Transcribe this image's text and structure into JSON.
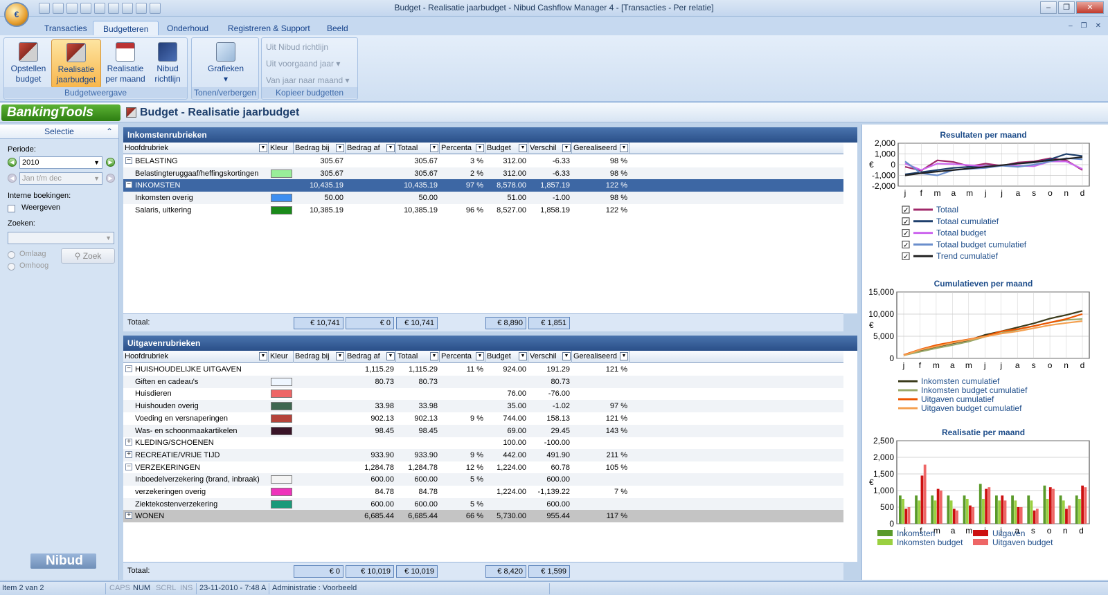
{
  "window_title": "Budget - Realisatie jaarbudget - Nibud Cashflow Manager 4 - [Transacties - Per relatie]",
  "tabs": [
    "Transacties",
    "Budgetteren",
    "Onderhoud",
    "Registreren & Support",
    "Beeld"
  ],
  "ribbon": {
    "group1_label": "Budgetweergave",
    "btn_opstellen": [
      "Opstellen",
      "budget"
    ],
    "btn_realisatie_jaar": [
      "Realisatie",
      "jaarbudget"
    ],
    "btn_realisatie_maand": [
      "Realisatie",
      "per maand"
    ],
    "btn_nibud": [
      "Nibud",
      "richtlijn"
    ],
    "group2_label": "Tonen/verbergen",
    "btn_grafieken": "Grafieken",
    "group3_label": "Kopieer budgetten",
    "uit_nibud": "Uit Nibud richtlijn",
    "uit_voorgaand": "Uit voorgaand jaar",
    "van_jaar": "Van jaar naar maand"
  },
  "logo_text": "BankingTools",
  "page_title": "Budget - Realisatie jaarbudget",
  "sidebar": {
    "header": "Selectie",
    "periode_label": "Periode:",
    "year_value": "2010",
    "month_range": "Jan t/m dec",
    "interne_label": "Interne boekingen:",
    "weergeven": "Weergeven",
    "zoeken_label": "Zoeken:",
    "omlaag": "Omlaag",
    "omhoog": "Omhoog",
    "zoek_button": "Zoek",
    "nibud_logo": "Nibud"
  },
  "columns": [
    "Hoofdrubriek",
    "Kleur",
    "Bedrag bij",
    "Bedrag af",
    "Totaal",
    "Percenta",
    "Budget",
    "Verschil",
    "Gerealiseerd"
  ],
  "income": {
    "title": "Inkomstenrubrieken",
    "rows": [
      {
        "exp": "−",
        "name": "BELASTING",
        "color": "",
        "bij": "305.67",
        "af": "",
        "tot": "305.67",
        "pct": "3 %",
        "bud": "312.00",
        "ver": "-6.33",
        "ger": "98 %",
        "bold": true
      },
      {
        "exp": "",
        "name": "Belastingteruggaaf/heffingskortingen",
        "color": "#99ee99",
        "bij": "305.67",
        "af": "",
        "tot": "305.67",
        "pct": "2 %",
        "bud": "312.00",
        "ver": "-6.33",
        "ger": "98 %"
      },
      {
        "exp": "−",
        "name": "INKOMSTEN",
        "color": "",
        "bij": "10,435.19",
        "af": "",
        "tot": "10,435.19",
        "pct": "97 %",
        "bud": "8,578.00",
        "ver": "1,857.19",
        "ger": "122 %",
        "sel": true
      },
      {
        "exp": "",
        "name": "Inkomsten overig",
        "color": "#3d8ef0",
        "bij": "50.00",
        "af": "",
        "tot": "50.00",
        "pct": "",
        "bud": "51.00",
        "ver": "-1.00",
        "ger": "98 %"
      },
      {
        "exp": "",
        "name": "Salaris, uitkering",
        "color": "#1a8a1a",
        "bij": "10,385.19",
        "af": "",
        "tot": "10,385.19",
        "pct": "96 %",
        "bud": "8,527.00",
        "ver": "1,858.19",
        "ger": "122 %"
      }
    ],
    "footer": {
      "label": "Totaal:",
      "bij": "€ 10,741",
      "af": "€ 0",
      "tot": "€ 10,741",
      "bud": "€ 8,890",
      "ver": "€ 1,851"
    }
  },
  "expense": {
    "title": "Uitgavenrubrieken",
    "rows": [
      {
        "exp": "−",
        "name": "HUISHOUDELIJKE UITGAVEN",
        "color": "",
        "bij": "",
        "af": "1,115.29",
        "tot": "1,115.29",
        "pct": "11 %",
        "bud": "924.00",
        "ver": "191.29",
        "ger": "121 %"
      },
      {
        "exp": "",
        "name": "Giften en cadeau's",
        "color": "#eef6ff",
        "bij": "",
        "af": "80.73",
        "tot": "80.73",
        "pct": "",
        "bud": "",
        "ver": "80.73",
        "ger": ""
      },
      {
        "exp": "",
        "name": "Huisdieren",
        "color": "#ee6666",
        "bij": "",
        "af": "",
        "tot": "",
        "pct": "",
        "bud": "76.00",
        "ver": "-76.00",
        "ger": ""
      },
      {
        "exp": "",
        "name": "Huishouden overig",
        "color": "#3e6650",
        "bij": "",
        "af": "33.98",
        "tot": "33.98",
        "pct": "",
        "bud": "35.00",
        "ver": "-1.02",
        "ger": "97 %"
      },
      {
        "exp": "",
        "name": "Voeding en versnaperingen",
        "color": "#b4433a",
        "bij": "",
        "af": "902.13",
        "tot": "902.13",
        "pct": "9 %",
        "bud": "744.00",
        "ver": "158.13",
        "ger": "121 %"
      },
      {
        "exp": "",
        "name": "Was- en schoonmaakartikelen",
        "color": "#3a1428",
        "bij": "",
        "af": "98.45",
        "tot": "98.45",
        "pct": "",
        "bud": "69.00",
        "ver": "29.45",
        "ger": "143 %"
      },
      {
        "exp": "+",
        "name": "KLEDING/SCHOENEN",
        "color": "",
        "bij": "",
        "af": "",
        "tot": "",
        "pct": "",
        "bud": "100.00",
        "ver": "-100.00",
        "ger": ""
      },
      {
        "exp": "+",
        "name": "RECREATIE/VRIJE TIJD",
        "color": "",
        "bij": "",
        "af": "933.90",
        "tot": "933.90",
        "pct": "9 %",
        "bud": "442.00",
        "ver": "491.90",
        "ger": "211 %"
      },
      {
        "exp": "−",
        "name": "VERZEKERINGEN",
        "color": "",
        "bij": "",
        "af": "1,284.78",
        "tot": "1,284.78",
        "pct": "12 %",
        "bud": "1,224.00",
        "ver": "60.78",
        "ger": "105 %"
      },
      {
        "exp": "",
        "name": "Inboedelverzekering (brand, inbraak)",
        "color": "#f4f4f4",
        "bij": "",
        "af": "600.00",
        "tot": "600.00",
        "pct": "5 %",
        "bud": "",
        "ver": "600.00",
        "ger": ""
      },
      {
        "exp": "",
        "name": "verzekeringen overig",
        "color": "#ee33bb",
        "bij": "",
        "af": "84.78",
        "tot": "84.78",
        "pct": "",
        "bud": "1,224.00",
        "ver": "-1,139.22",
        "ger": "7 %"
      },
      {
        "exp": "",
        "name": "Ziektekostenverzekering",
        "color": "#1a9a7a",
        "bij": "",
        "af": "600.00",
        "tot": "600.00",
        "pct": "5 %",
        "bud": "",
        "ver": "600.00",
        "ger": ""
      },
      {
        "exp": "+",
        "name": "WONEN",
        "color": "",
        "bij": "",
        "af": "6,685.44",
        "tot": "6,685.44",
        "pct": "66 %",
        "bud": "5,730.00",
        "ver": "955.44",
        "ger": "117 %",
        "grey": true
      }
    ],
    "footer": {
      "label": "Totaal:",
      "bij": "€ 0",
      "af": "€ 10,019",
      "tot": "€ 10,019",
      "bud": "€ 8,420",
      "ver": "€ 1,599"
    }
  },
  "chart_data": [
    {
      "type": "line",
      "title": "Resultaten per maand",
      "ylabel": "€",
      "categories": [
        "j",
        "f",
        "m",
        "a",
        "m",
        "j",
        "j",
        "a",
        "s",
        "o",
        "n",
        "d"
      ],
      "ylim": [
        -2000,
        2000
      ],
      "yticks": [
        "2,000",
        "1,000",
        "0",
        "-1,000",
        "-2,000"
      ],
      "series": [
        {
          "name": "Totaal",
          "color": "#a0286a",
          "values": [
            -200,
            -550,
            400,
            250,
            -150,
            100,
            -100,
            200,
            300,
            600,
            400,
            -500
          ]
        },
        {
          "name": "Totaal cumulatief",
          "color": "#1e3f6c",
          "values": [
            -900,
            -700,
            -500,
            -300,
            -200,
            -100,
            -100,
            100,
            200,
            500,
            1000,
            800
          ]
        },
        {
          "name": "Totaal budget",
          "color": "#cc66ee",
          "values": [
            100,
            -500,
            100,
            50,
            -50,
            -150,
            -50,
            -100,
            -150,
            300,
            300,
            -400
          ]
        },
        {
          "name": "Totaal budget cumulatief",
          "color": "#6a8ecc",
          "values": [
            300,
            -800,
            -1000,
            -500,
            -400,
            -300,
            -100,
            -200,
            0,
            300,
            600,
            500
          ]
        },
        {
          "name": "Trend cumulatief",
          "color": "#222222",
          "values": [
            -1000,
            -800,
            -650,
            -500,
            -350,
            -200,
            -50,
            100,
            250,
            400,
            550,
            700
          ]
        }
      ]
    },
    {
      "type": "line",
      "title": "Cumulatieven per maand",
      "ylabel": "€",
      "categories": [
        "j",
        "f",
        "m",
        "a",
        "m",
        "j",
        "j",
        "a",
        "s",
        "o",
        "n",
        "d"
      ],
      "ylim": [
        0,
        15000
      ],
      "yticks": [
        "15,000",
        "10,000",
        "5,000",
        "0"
      ],
      "series": [
        {
          "name": "Inkomsten cumulatief",
          "color": "#3a3a1a",
          "values": [
            700,
            1700,
            2600,
            3400,
            4100,
            5300,
            6100,
            7000,
            7900,
            9000,
            9800,
            10741
          ]
        },
        {
          "name": "Inkomsten budget cumulatief",
          "color": "#9aa86a",
          "values": [
            700,
            1500,
            2300,
            3000,
            3800,
            4900,
            5700,
            6500,
            7300,
            8100,
            8700,
            8890
          ]
        },
        {
          "name": "Uitgaven cumulatief",
          "color": "#ee5500",
          "values": [
            800,
            2000,
            3000,
            3700,
            4300,
            5000,
            6100,
            6600,
            7300,
            8100,
            8900,
            10019
          ]
        },
        {
          "name": "Uitgaven budget cumulatief",
          "color": "#f4a050",
          "values": [
            700,
            1900,
            2700,
            3500,
            4200,
            4900,
            5600,
            6100,
            6800,
            7500,
            8000,
            8420
          ]
        }
      ]
    },
    {
      "type": "bar",
      "title": "Realisatie per maand",
      "ylabel": "€",
      "categories": [
        "j",
        "f",
        "m",
        "a",
        "m",
        "j",
        "j",
        "a",
        "s",
        "o",
        "n",
        "d"
      ],
      "ylim": [
        0,
        2500
      ],
      "yticks": [
        "2,500",
        "2,000",
        "1,500",
        "1,000",
        "500",
        "0"
      ],
      "series": [
        {
          "name": "Inkomsten",
          "color": "#5a9a2a",
          "values": [
            850,
            850,
            850,
            850,
            850,
            1200,
            850,
            850,
            850,
            1150,
            850,
            850
          ]
        },
        {
          "name": "Inkomsten budget",
          "color": "#9ad040",
          "values": [
            750,
            700,
            700,
            700,
            750,
            750,
            700,
            700,
            700,
            750,
            700,
            750
          ]
        },
        {
          "name": "Uitgaven",
          "color": "#cc1010",
          "values": [
            450,
            1450,
            1050,
            450,
            550,
            1050,
            850,
            500,
            400,
            1100,
            450,
            1150
          ]
        },
        {
          "name": "Uitgaven budget",
          "color": "#ee6666",
          "values": [
            500,
            1780,
            1000,
            400,
            500,
            1100,
            700,
            500,
            450,
            1050,
            550,
            1100
          ]
        }
      ]
    }
  ],
  "status": {
    "item": "Item 2 van 2",
    "caps": "CAPS",
    "num": "NUM",
    "scrl": "SCRL",
    "ins": "INS",
    "datetime": "23-11-2010 - 7:48 A",
    "admin": "Administratie : Voorbeeld"
  }
}
